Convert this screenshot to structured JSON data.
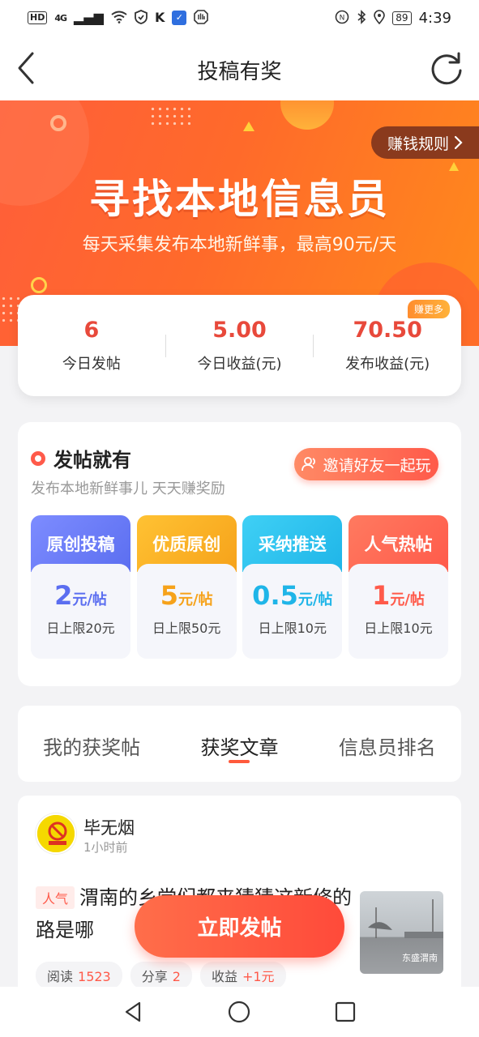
{
  "status_bar": {
    "hd": "HD",
    "signal": "4G",
    "battery": "89",
    "time": "4:39"
  },
  "nav": {
    "title": "投稿有奖",
    "back_icon": "chevron-left-icon",
    "refresh_icon": "refresh-icon"
  },
  "banner": {
    "title": "寻找本地信息员",
    "subtitle": "每天采集发布本地新鲜事，最高90元/天",
    "rules_label": "赚钱规则"
  },
  "stats": {
    "earn_more": "赚更多",
    "items": [
      {
        "value": "6",
        "label": "今日发帖"
      },
      {
        "value": "5.00",
        "label": "今日收益(元)"
      },
      {
        "value": "70.50",
        "label": "发布收益(元)"
      }
    ]
  },
  "tasks": {
    "title": "发帖就有",
    "subtitle": "发布本地新鲜事儿 天天赚奖励",
    "invite_label": "邀请好友一起玩",
    "tiles": [
      {
        "name": "原创投稿",
        "num": "2",
        "unit": "元/帖",
        "limit": "日上限20元",
        "color": "#5b6ef0"
      },
      {
        "name": "优质原创",
        "num": "5",
        "unit": "元/帖",
        "limit": "日上限50元",
        "color": "#f6a21a"
      },
      {
        "name": "采纳推送",
        "num": "0.5",
        "unit": "元/帖",
        "limit": "日上限10元",
        "color": "#1fb5e8"
      },
      {
        "name": "人气热帖",
        "num": "1",
        "unit": "元/帖",
        "limit": "日上限10元",
        "color": "#ff5a4a"
      }
    ]
  },
  "tabs": {
    "items": [
      "我的获奖帖",
      "获奖文章",
      "信息员排名"
    ],
    "active": "获奖文章"
  },
  "article": {
    "author": "毕无烟",
    "time": "1小时前",
    "tag": "人气",
    "title": "渭南的乡党们都来猜猜这新修的路是哪",
    "thumb_text": "东盛渭南",
    "chips": [
      {
        "label": "阅读",
        "value": "1523"
      },
      {
        "label": "分享",
        "value": "2"
      },
      {
        "label": "收益",
        "value": "+1元"
      }
    ]
  },
  "post_button": "立即发帖"
}
